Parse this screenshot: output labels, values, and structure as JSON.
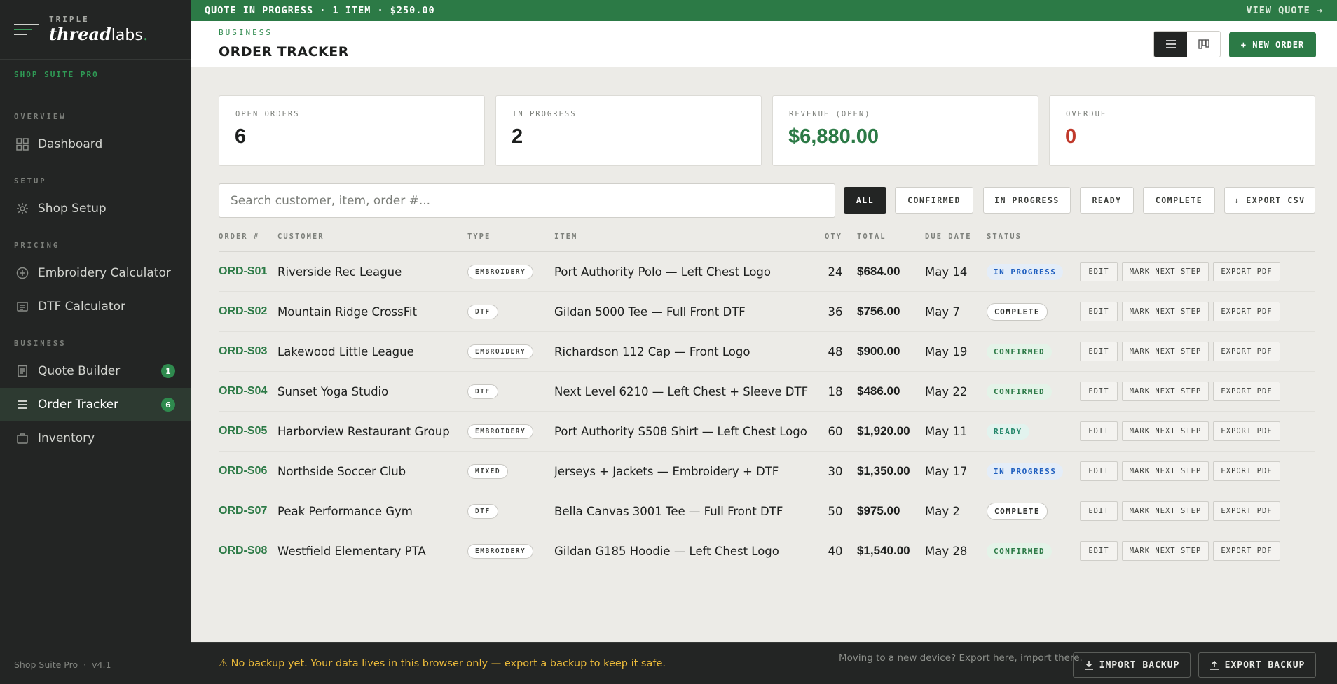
{
  "brand": {
    "top": "TRIPLE",
    "thread": "thread",
    "labs": "labs",
    "dot": ".",
    "suite": "SHOP SUITE PRO"
  },
  "nav": {
    "sections": {
      "overview": "OVERVIEW",
      "setup": "SETUP",
      "pricing": "PRICING",
      "business": "BUSINESS"
    },
    "items": [
      {
        "label": "Dashboard",
        "icon": "grid-icon"
      },
      {
        "label": "Shop Setup",
        "icon": "gear-icon"
      },
      {
        "label": "Embroidery Calculator",
        "icon": "plus-circle-icon"
      },
      {
        "label": "DTF Calculator",
        "icon": "receipt-icon"
      },
      {
        "label": "Quote Builder",
        "icon": "document-icon",
        "badge": "1"
      },
      {
        "label": "Order Tracker",
        "icon": "list-icon",
        "badge": "6",
        "active": true
      },
      {
        "label": "Inventory",
        "icon": "bag-icon"
      }
    ]
  },
  "sidebar_footer": {
    "name": "Shop Suite Pro",
    "sep": "·",
    "version": "v4.1"
  },
  "banner": {
    "text": "QUOTE IN PROGRESS · 1 ITEM · $250.00",
    "link": "VIEW QUOTE →"
  },
  "header": {
    "crumb": "BUSINESS",
    "title": "ORDER TRACKER",
    "new_order": "+ NEW ORDER"
  },
  "stats": [
    {
      "label": "OPEN ORDERS",
      "value": "6"
    },
    {
      "label": "IN PROGRESS",
      "value": "2"
    },
    {
      "label": "REVENUE (OPEN)",
      "value": "$6,880.00"
    },
    {
      "label": "OVERDUE",
      "value": "0"
    }
  ],
  "search": {
    "placeholder": "Search customer, item, order #..."
  },
  "filters": [
    "ALL",
    "CONFIRMED",
    "IN PROGRESS",
    "READY",
    "COMPLETE"
  ],
  "export_csv": "↓ EXPORT CSV",
  "table": {
    "headers": [
      "ORDER #",
      "CUSTOMER",
      "TYPE",
      "ITEM",
      "QTY",
      "TOTAL",
      "DUE DATE",
      "STATUS"
    ],
    "actions": {
      "edit": "EDIT",
      "next": "MARK NEXT STEP",
      "pdf": "EXPORT PDF"
    },
    "rows": [
      {
        "id": "ORD-S01",
        "customer": "Riverside Rec League",
        "type": "EMBROIDERY",
        "item": "Port Authority Polo — Left Chest Logo",
        "qty": "24",
        "total": "$684.00",
        "due": "May 14",
        "status": "IN PROGRESS"
      },
      {
        "id": "ORD-S02",
        "customer": "Mountain Ridge CrossFit",
        "type": "DTF",
        "item": "Gildan 5000 Tee — Full Front DTF",
        "qty": "36",
        "total": "$756.00",
        "due": "May 7",
        "status": "COMPLETE"
      },
      {
        "id": "ORD-S03",
        "customer": "Lakewood Little League",
        "type": "EMBROIDERY",
        "item": "Richardson 112 Cap — Front Logo",
        "qty": "48",
        "total": "$900.00",
        "due": "May 19",
        "status": "CONFIRMED"
      },
      {
        "id": "ORD-S04",
        "customer": "Sunset Yoga Studio",
        "type": "DTF",
        "item": "Next Level 6210 — Left Chest + Sleeve DTF",
        "qty": "18",
        "total": "$486.00",
        "due": "May 22",
        "status": "CONFIRMED"
      },
      {
        "id": "ORD-S05",
        "customer": "Harborview Restaurant Group",
        "type": "EMBROIDERY",
        "item": "Port Authority S508 Shirt — Left Chest Logo",
        "qty": "60",
        "total": "$1,920.00",
        "due": "May 11",
        "status": "READY"
      },
      {
        "id": "ORD-S06",
        "customer": "Northside Soccer Club",
        "type": "MIXED",
        "item": "Jerseys + Jackets — Embroidery + DTF",
        "qty": "30",
        "total": "$1,350.00",
        "due": "May 17",
        "status": "IN PROGRESS"
      },
      {
        "id": "ORD-S07",
        "customer": "Peak Performance Gym",
        "type": "DTF",
        "item": "Bella Canvas 3001 Tee — Full Front DTF",
        "qty": "50",
        "total": "$975.00",
        "due": "May 2",
        "status": "COMPLETE"
      },
      {
        "id": "ORD-S08",
        "customer": "Westfield Elementary PTA",
        "type": "EMBROIDERY",
        "item": "Gildan G185 Hoodie — Left Chest Logo",
        "qty": "40",
        "total": "$1,540.00",
        "due": "May 28",
        "status": "CONFIRMED"
      }
    ]
  },
  "bottom": {
    "warning": "⚠ No backup yet. Your data lives in this browser only — export a backup to keep it safe.",
    "moving": "Moving to a new device? Export here, import there.",
    "import": "IMPORT BACKUP",
    "export": "EXPORT BACKUP"
  },
  "colors": {
    "accent": "#2c7a46",
    "sidebar": "#232524",
    "background": "#ecebe7",
    "danger": "#c0392b",
    "warning": "#e9b93a"
  }
}
